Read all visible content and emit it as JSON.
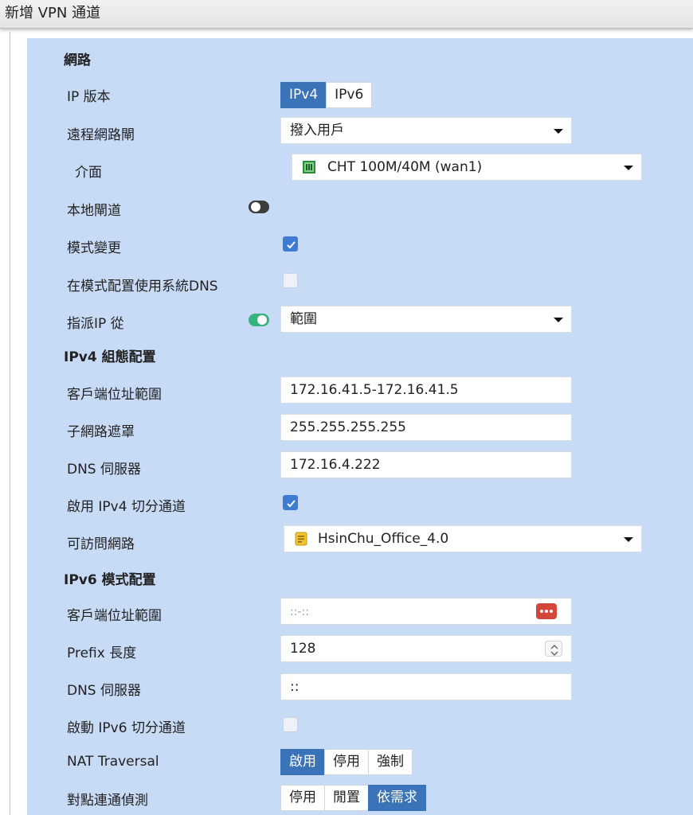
{
  "window": {
    "title": "新增 VPN 通道"
  },
  "sections": {
    "network": "網路",
    "ipv4": "IPv4 組態配置",
    "ipv6": "IPv6 模式配置"
  },
  "ip_version": {
    "label": "IP 版本",
    "options": [
      "IPv4",
      "IPv6"
    ],
    "selected": "IPv4"
  },
  "remote_gateway": {
    "label": "遠程網路閘",
    "value": "撥入用戶"
  },
  "interface": {
    "label": "介面",
    "value": "CHT 100M/40M (wan1)"
  },
  "local_gateway": {
    "label": "本地閘道",
    "enabled": false
  },
  "mode_config": {
    "label": "模式變更",
    "checked": true
  },
  "use_system_dns": {
    "label": "在模式配置使用系統DNS",
    "checked": false
  },
  "assign_ip_from": {
    "label": "指派IP 從",
    "enabled": true,
    "value": "範圍"
  },
  "ipv4": {
    "client_range": {
      "label": "客戶端位址範圍",
      "value": "172.16.41.5-172.16.41.5"
    },
    "subnet_mask": {
      "label": "子網路遮罩",
      "value": "255.255.255.255"
    },
    "dns_server": {
      "label": "DNS 伺服器",
      "value": "172.16.4.222"
    },
    "split_tunnel": {
      "label": "啟用 IPv4 切分通道",
      "checked": true
    },
    "accessible_networks": {
      "label": "可訪問網路",
      "value": "HsinChu_Office_4.0"
    }
  },
  "ipv6": {
    "client_range": {
      "label": "客戶端位址範圍",
      "placeholder": "::-::"
    },
    "prefix_length": {
      "label": "Prefix 長度",
      "value": "128"
    },
    "dns_server": {
      "label": "DNS 伺服器",
      "value": "::"
    },
    "split_tunnel": {
      "label": "啟動 IPv6 切分通道",
      "checked": false
    }
  },
  "nat_traversal": {
    "label": "NAT Traversal",
    "options": [
      "啟用",
      "停用",
      "強制"
    ],
    "selected": "啟用"
  },
  "dead_peer_detection": {
    "label": "對點連通偵測",
    "options": [
      "停用",
      "閒置",
      "依需求"
    ],
    "selected": "依需求"
  },
  "colors": {
    "panel": "#c8dbf6",
    "accent": "#3a73b8",
    "toggle_on": "#36b27d",
    "checkbox": "#3f7bd0"
  }
}
